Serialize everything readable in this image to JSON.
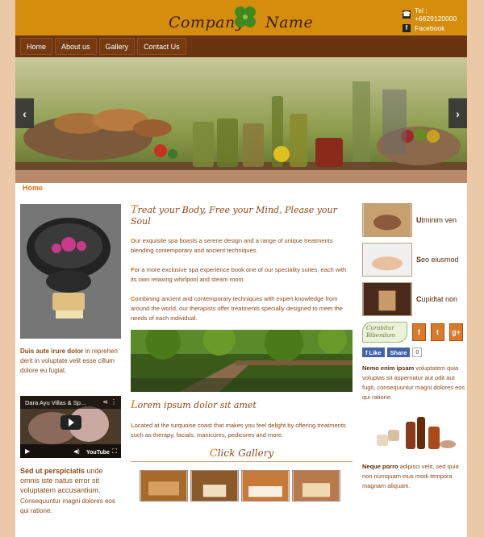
{
  "brand": {
    "name_left": "Company",
    "name_right": "Name"
  },
  "contact": {
    "phone": "Tel : +6629120000",
    "facebook": "Facebook"
  },
  "nav": [
    {
      "label": "Home"
    },
    {
      "label": "About us"
    },
    {
      "label": "Gallery"
    },
    {
      "label": "Contact Us"
    }
  ],
  "hero": {
    "prev": "‹",
    "next": "›"
  },
  "breadcrumb": "Home",
  "left": {
    "block1_title": "Duis aute irure dolor",
    "block1_text": " in reprehen derit in voluptate velit esse cillum dolore eu fugiat.",
    "video_title": "Dara Ayu Villas & Sp...",
    "video_logo": "YouTube",
    "block2_title": "Sed ut perspiciatis",
    "block2_text": " unde omnis iste natus error sit voluptatem accusantium.",
    "block2_sub": "Consequuntur magni dolores eos qui ratione."
  },
  "center": {
    "headline_first": "T",
    "headline_rest": "reat your Body, Free your Mind, Please your Soul",
    "p1_first": "O",
    "p1": "ur exquisite spa boasts a serene design and a range of unique treatments blending contemporary and ancient techniques.",
    "p2_first": "F",
    "p2": "or a more exclusive spa experience book one of our speciality suites, each with its own relaxing whirlpool and steam room.",
    "p3_first": "C",
    "p3": "ombining ancient and contemporary techniques with expert knowledge from around the world, our therapists offer treatments specially designed to meet the needs of each individual.",
    "h2_first": "L",
    "h2_rest": "orem ipsum dolor sit amet",
    "p4_first": "L",
    "p4": "ocated at the turquoise coast that makes you feel delight by offering treatments such as therapy, facials, manicures, pedicures and more.",
    "gallery_first": "C",
    "gallery_rest": "lick Gallery"
  },
  "right": {
    "items": [
      {
        "first": "U",
        "label": "tminim ven"
      },
      {
        "first": "S",
        "label": "eo eiusmod"
      },
      {
        "first": "C",
        "label": "upidtat non"
      }
    ],
    "badge_line1": "Curabitur",
    "badge_line2": "Bibendum",
    "social": [
      "f",
      "t",
      "g+"
    ],
    "like": "Like",
    "share": "Share",
    "share_count": "0",
    "block1_title": "Nemo enim ipsam",
    "block1_text": " voluptatem quia voluptas sit aspernatur aut odit aut fugit, consequuntur magni dolores eos qui ratione.",
    "block2_title": "Neque porro",
    "block2_text": " adipisci velit, sed quia non numquam eius modi tempora magnam aliquam."
  },
  "colors": {
    "header": "#d58d0e",
    "nav": "#6a3410",
    "accent": "#d8710e",
    "text": "#8a4a1a",
    "background": "#ecc9a6"
  },
  "icons": [
    "phone-icon",
    "facebook-icon",
    "clover-logo-icon",
    "play-icon",
    "share-icon"
  ]
}
